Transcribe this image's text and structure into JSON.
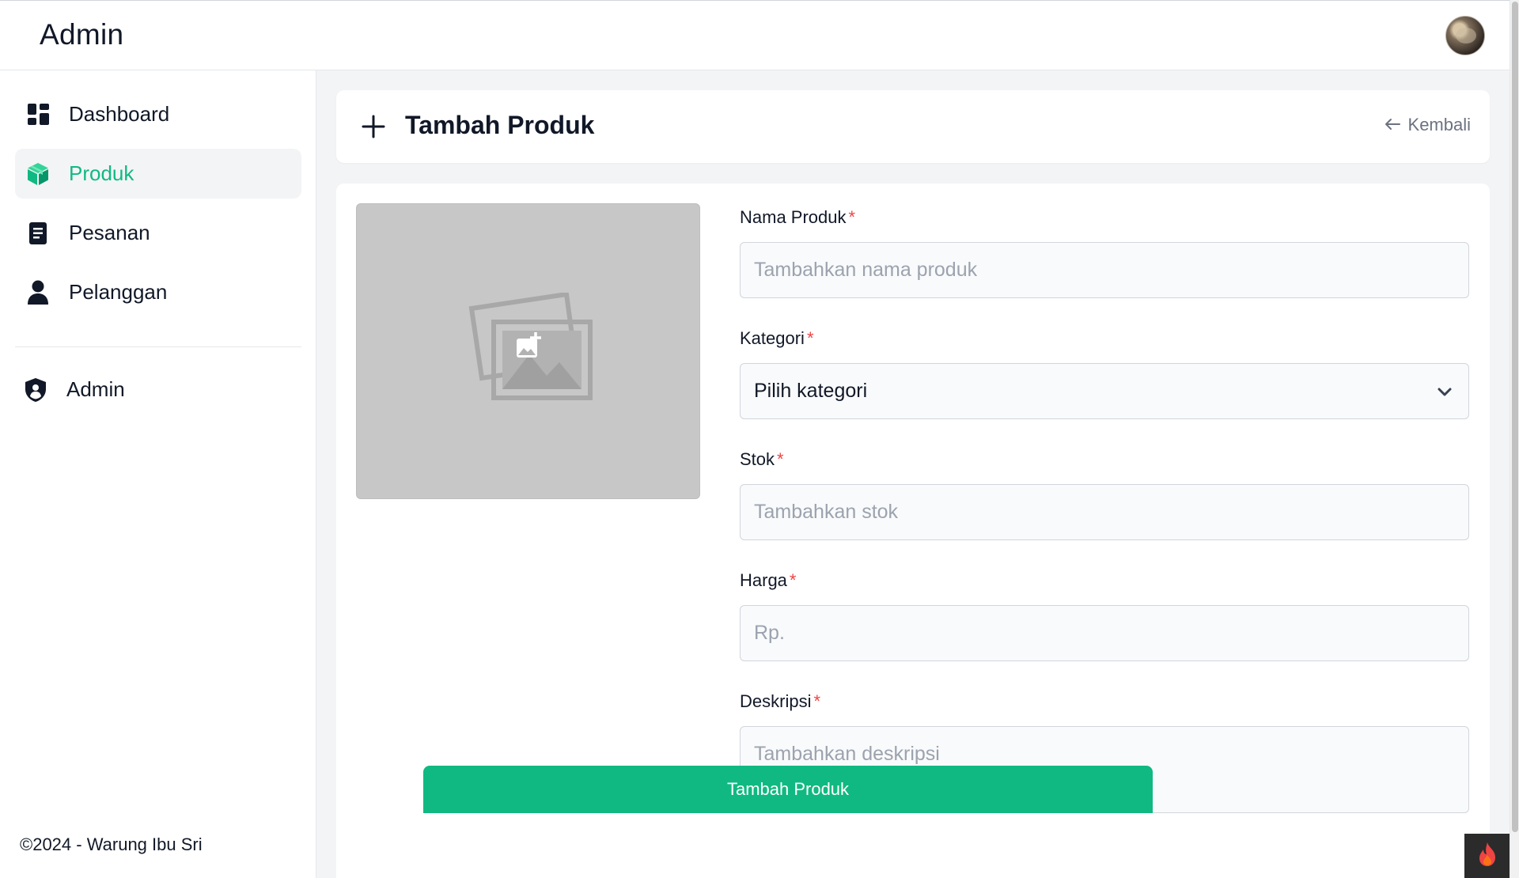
{
  "header": {
    "brand": "Admin"
  },
  "sidebar": {
    "items": [
      {
        "label": "Dashboard",
        "icon": "dashboard-icon"
      },
      {
        "label": "Produk",
        "icon": "box-icon",
        "active": true
      },
      {
        "label": "Pesanan",
        "icon": "document-icon"
      },
      {
        "label": "Pelanggan",
        "icon": "user-icon"
      }
    ],
    "admin_item": {
      "label": "Admin",
      "icon": "shield-icon"
    },
    "footer": "©2024 - Warung Ibu Sri"
  },
  "page": {
    "title": "Tambah Produk",
    "back_label": "Kembali"
  },
  "form": {
    "name": {
      "label": "Nama Produk",
      "required": "*",
      "placeholder": "Tambahkan nama produk"
    },
    "category": {
      "label": "Kategori",
      "required": "*",
      "selected": "Pilih kategori"
    },
    "stock": {
      "label": "Stok",
      "required": "*",
      "placeholder": "Tambahkan stok"
    },
    "price": {
      "label": "Harga",
      "required": "*",
      "placeholder": "Rp."
    },
    "description": {
      "label": "Deskripsi",
      "required": "*",
      "placeholder": "Tambahkan deskripsi"
    },
    "submit_label": "Tambah Produk"
  },
  "colors": {
    "accent": "#10b981",
    "required": "#ef4444"
  }
}
